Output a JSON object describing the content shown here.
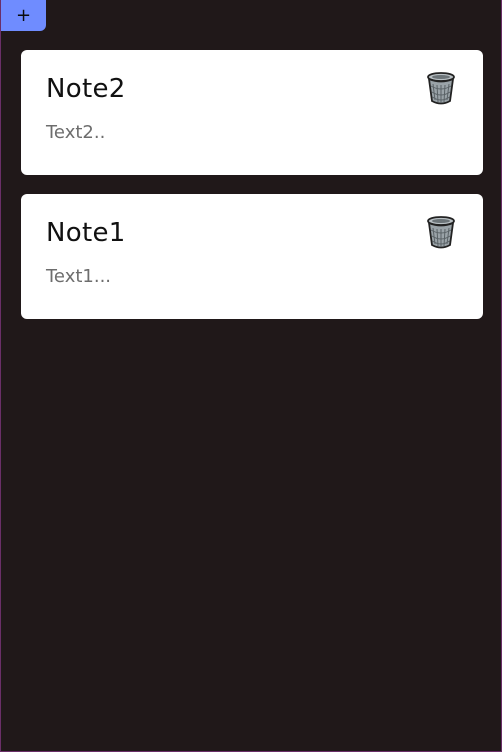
{
  "toolbar": {
    "add_label": "+"
  },
  "notes": [
    {
      "title": "Note2",
      "text": "Text2..",
      "delete_icon": "trash-can-icon"
    },
    {
      "title": "Note1",
      "text": "Text1...",
      "delete_icon": "trash-can-icon"
    }
  ],
  "colors": {
    "background": "#201819",
    "card": "#ffffff",
    "add_button": "#6f8cff",
    "title_text": "#111111",
    "body_text": "#6d6d6d"
  }
}
